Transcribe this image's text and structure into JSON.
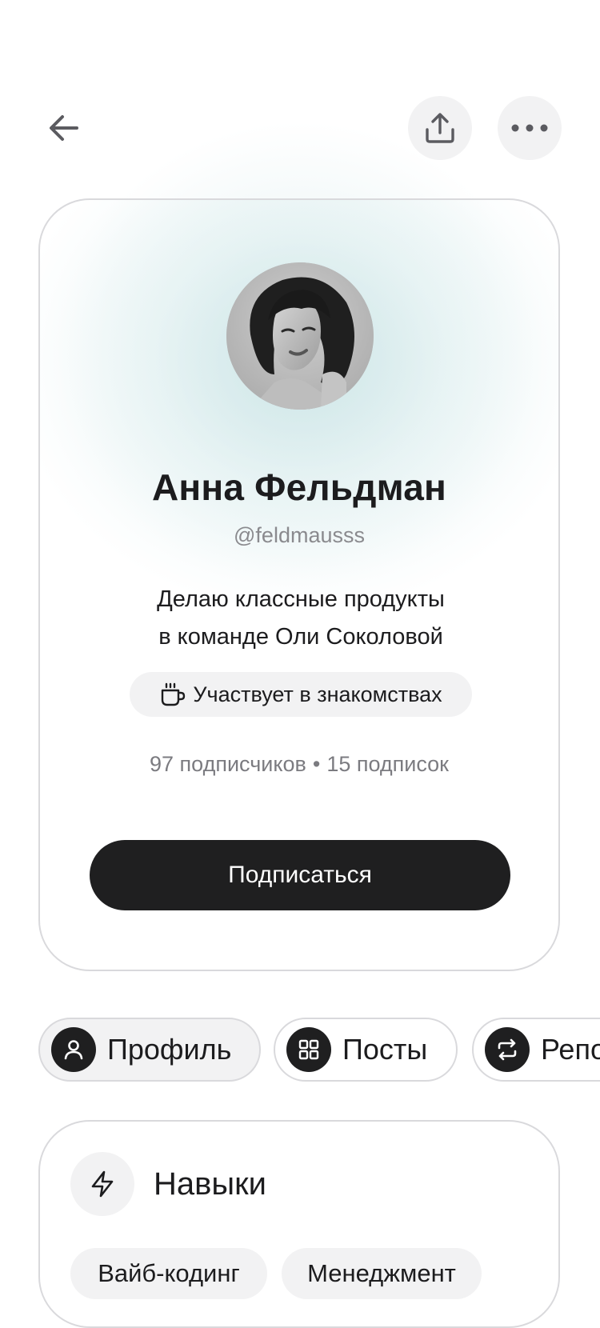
{
  "profile": {
    "name": "Анна Фельдман",
    "handle": "@feldmausss",
    "bio_line1": "Делаю классные продукты",
    "bio_line2": "в команде Оли Соколовой",
    "dating_badge": "Участвует в знакомствах",
    "followers": "97 подписчиков",
    "following": "15 подписок",
    "separator": "•",
    "follow_label": "Подписаться"
  },
  "tabs": [
    {
      "label": "Профиль",
      "icon": "person-icon",
      "active": true
    },
    {
      "label": "Посты",
      "icon": "grid-icon",
      "active": false
    },
    {
      "label": "Репосты",
      "icon": "repost-icon",
      "active": false
    }
  ],
  "skills": {
    "title": "Навыки",
    "icon": "lightning-icon",
    "items": [
      "Вайб-кодинг",
      "Менеджмент"
    ]
  },
  "colors": {
    "primary_button": "#1f1f20",
    "chip_bg": "#f2f2f3",
    "border": "#d9d9dc",
    "muted_text": "#8a8a8e",
    "glow": "#c6e2e4"
  }
}
